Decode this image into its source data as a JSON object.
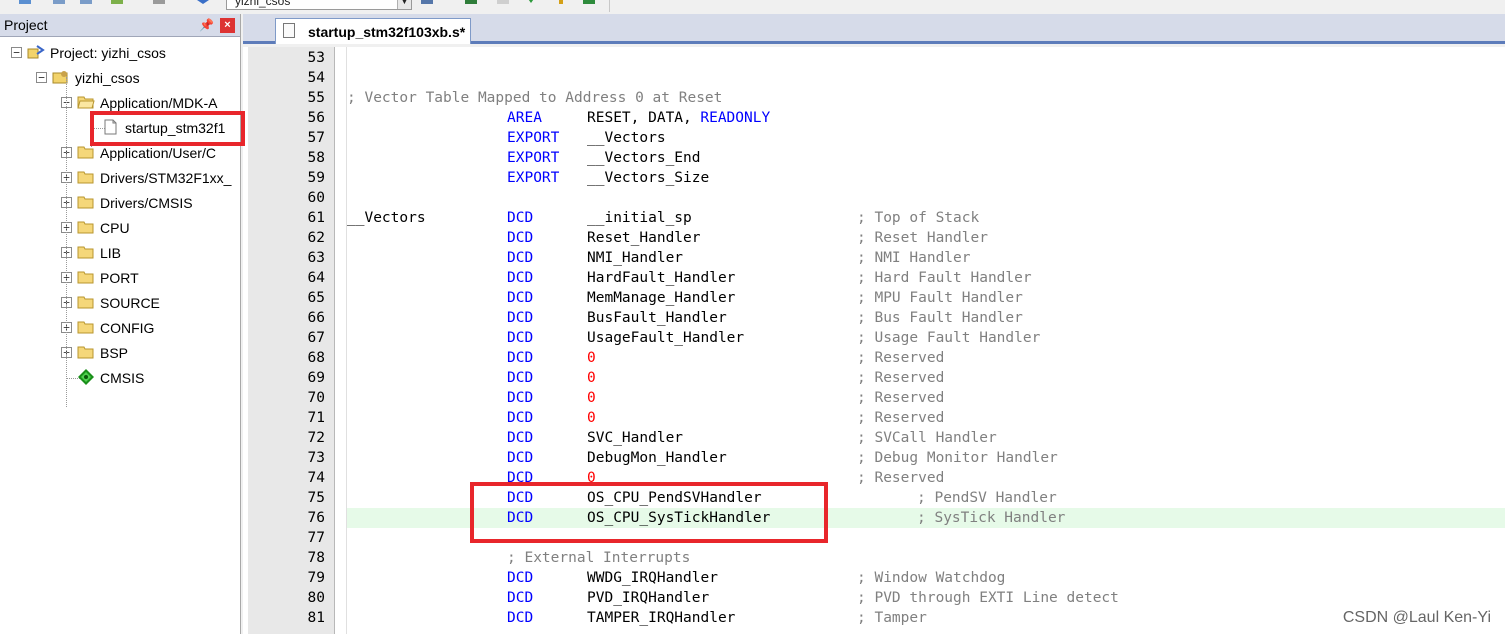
{
  "toolbar": {
    "target_select": "yizhi_csos"
  },
  "project_panel": {
    "title": "Project",
    "pin_glyph": "ᵖ",
    "close_glyph": "×",
    "tree": [
      {
        "label": "Project: yizhi_csos",
        "icon": "project-icon",
        "expander": "−"
      },
      {
        "label": "yizhi_csos",
        "icon": "target-icon",
        "expander": "−"
      },
      {
        "label": "Application/MDK-A",
        "icon": "folder-open-icon",
        "expander": "−"
      },
      {
        "label": "startup_stm32f1",
        "icon": "file-icon",
        "expander": ""
      },
      {
        "label": "Application/User/C",
        "icon": "folder-icon",
        "expander": "+"
      },
      {
        "label": "Drivers/STM32F1xx_",
        "icon": "folder-icon",
        "expander": "+"
      },
      {
        "label": "Drivers/CMSIS",
        "icon": "folder-icon",
        "expander": "+"
      },
      {
        "label": "CPU",
        "icon": "folder-icon",
        "expander": "+"
      },
      {
        "label": "LIB",
        "icon": "folder-icon",
        "expander": "+"
      },
      {
        "label": "PORT",
        "icon": "folder-icon",
        "expander": "+"
      },
      {
        "label": "SOURCE",
        "icon": "folder-icon",
        "expander": "+"
      },
      {
        "label": "CONFIG",
        "icon": "folder-icon",
        "expander": "+"
      },
      {
        "label": "BSP",
        "icon": "folder-icon",
        "expander": "+"
      },
      {
        "label": "CMSIS",
        "icon": "cmsis-component-icon",
        "expander": ""
      }
    ]
  },
  "editor": {
    "tab_label": "startup_stm32f103xb.s*",
    "current_line": 76,
    "lines": [
      {
        "n": "53",
        "label": "",
        "op": "",
        "arg": "",
        "comment": ""
      },
      {
        "n": "54",
        "label": "",
        "op": "",
        "arg": "",
        "comment": ""
      },
      {
        "n": "55",
        "label": "; Vector Table Mapped to Address 0 at Reset",
        "op": "",
        "arg": "",
        "comment": ""
      },
      {
        "n": "56",
        "label": "",
        "op": "AREA",
        "arg": "RESET, DATA, ",
        "arg2": "READONLY",
        "comment": ""
      },
      {
        "n": "57",
        "label": "",
        "op": "EXPORT",
        "arg": "__Vectors",
        "comment": ""
      },
      {
        "n": "58",
        "label": "",
        "op": "EXPORT",
        "arg": "__Vectors_End",
        "comment": ""
      },
      {
        "n": "59",
        "label": "",
        "op": "EXPORT",
        "arg": "__Vectors_Size",
        "comment": ""
      },
      {
        "n": "60",
        "label": "",
        "op": "",
        "arg": "",
        "comment": ""
      },
      {
        "n": "61",
        "label": "__Vectors",
        "op": "DCD",
        "arg": "__initial_sp",
        "comment": "; Top of Stack"
      },
      {
        "n": "62",
        "label": "",
        "op": "DCD",
        "arg": "Reset_Handler",
        "comment": "; Reset Handler"
      },
      {
        "n": "63",
        "label": "",
        "op": "DCD",
        "arg": "NMI_Handler",
        "comment": "; NMI Handler"
      },
      {
        "n": "64",
        "label": "",
        "op": "DCD",
        "arg": "HardFault_Handler",
        "comment": "; Hard Fault Handler"
      },
      {
        "n": "65",
        "label": "",
        "op": "DCD",
        "arg": "MemManage_Handler",
        "comment": "; MPU Fault Handler"
      },
      {
        "n": "66",
        "label": "",
        "op": "DCD",
        "arg": "BusFault_Handler",
        "comment": "; Bus Fault Handler"
      },
      {
        "n": "67",
        "label": "",
        "op": "DCD",
        "arg": "UsageFault_Handler",
        "comment": "; Usage Fault Handler"
      },
      {
        "n": "68",
        "label": "",
        "op": "DCD",
        "num": "0",
        "comment": "; Reserved"
      },
      {
        "n": "69",
        "label": "",
        "op": "DCD",
        "num": "0",
        "comment": "; Reserved"
      },
      {
        "n": "70",
        "label": "",
        "op": "DCD",
        "num": "0",
        "comment": "; Reserved"
      },
      {
        "n": "71",
        "label": "",
        "op": "DCD",
        "num": "0",
        "comment": "; Reserved"
      },
      {
        "n": "72",
        "label": "",
        "op": "DCD",
        "arg": "SVC_Handler",
        "comment": "; SVCall Handler"
      },
      {
        "n": "73",
        "label": "",
        "op": "DCD",
        "arg": "DebugMon_Handler",
        "comment": "; Debug Monitor Handler"
      },
      {
        "n": "74",
        "label": "",
        "op": "DCD",
        "num": "0",
        "comment": "; Reserved"
      },
      {
        "n": "75",
        "label": "",
        "op": "DCD",
        "arg": "OS_CPU_PendSVHandler",
        "comment": "; PendSV Handler",
        "shift": true
      },
      {
        "n": "76",
        "label": "",
        "op": "DCD",
        "arg": "OS_CPU_SysTickHandler",
        "comment": "; SysTick Handler",
        "shift": true
      },
      {
        "n": "77",
        "label": "",
        "op": "",
        "arg": "",
        "comment": ""
      },
      {
        "n": "78",
        "label": "",
        "op": "",
        "arg": "",
        "comment": "",
        "indent_comment": "; External Interrupts"
      },
      {
        "n": "79",
        "label": "",
        "op": "DCD",
        "arg": "WWDG_IRQHandler",
        "comment": "; Window Watchdog"
      },
      {
        "n": "80",
        "label": "",
        "op": "DCD",
        "arg": "PVD_IRQHandler",
        "comment": "; PVD through EXTI Line detect"
      },
      {
        "n": "81",
        "label": "",
        "op": "DCD",
        "arg": "TAMPER_IRQHandler",
        "comment": "; Tamper"
      }
    ]
  },
  "watermark": "CSDN @Laul Ken-Yi",
  "colors": {
    "keyword": "#0000ff",
    "comment": "#808080",
    "number": "#ff0000",
    "highlight_box": "#e8262b",
    "current_line": "#e6fae8"
  }
}
